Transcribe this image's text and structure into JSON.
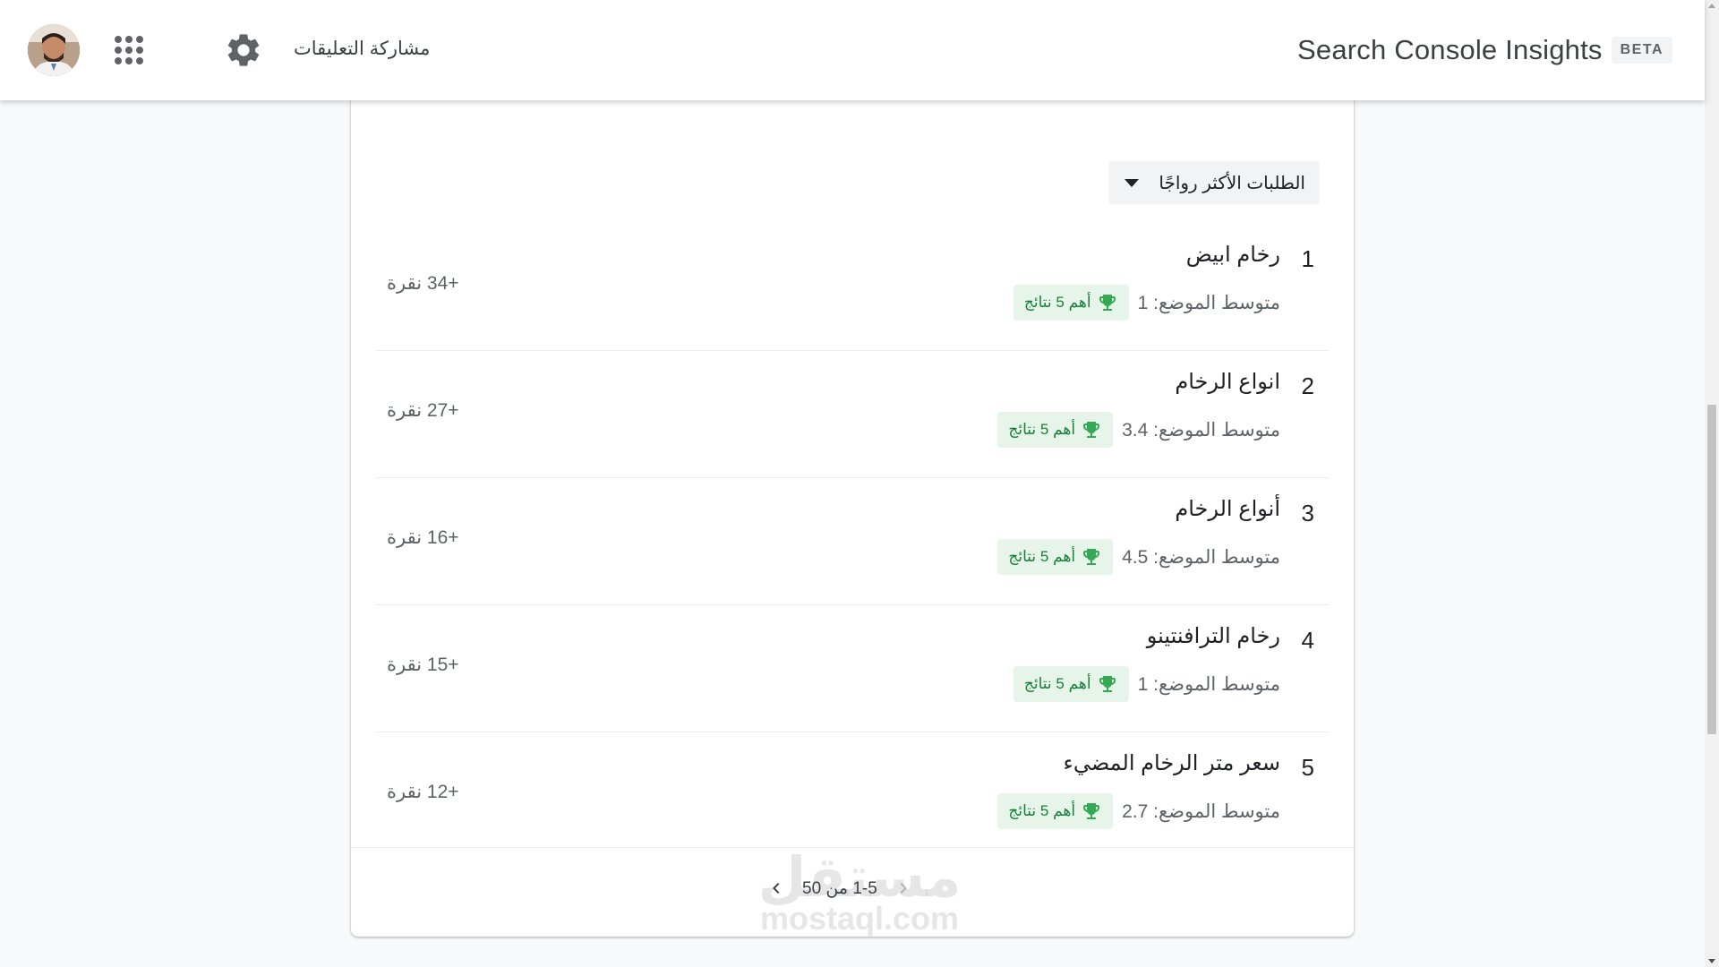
{
  "header": {
    "title": "Search Console Insights",
    "badge": "BETA",
    "feedback_label": "مشاركة التعليقات",
    "avatar_icon": "user-avatar-photo",
    "apps_icon": "apps-grid-icon",
    "settings_icon": "gear-icon"
  },
  "queries_card": {
    "dropdown_label": "الطلبات الأكثر رواجًا",
    "dropdown_icon": "caret-down-icon",
    "badge_icon": "trophy-icon",
    "items": [
      {
        "rank": "1",
        "query": "رخام ابيض",
        "avg_position": "متوسط الموضع: 1",
        "badge": "أهم 5 نتائج",
        "clicks": "+34 نقرة"
      },
      {
        "rank": "2",
        "query": "انواع الرخام",
        "avg_position": "متوسط الموضع: 3.4",
        "badge": "أهم 5 نتائج",
        "clicks": "+27 نقرة"
      },
      {
        "rank": "3",
        "query": "أنواع الرخام",
        "avg_position": "متوسط الموضع: 4.5",
        "badge": "أهم 5 نتائج",
        "clicks": "+16 نقرة"
      },
      {
        "rank": "4",
        "query": "رخام الترافنتينو",
        "avg_position": "متوسط الموضع: 1",
        "badge": "أهم 5 نتائج",
        "clicks": "+15 نقرة"
      },
      {
        "rank": "5",
        "query": "سعر متر الرخام المضيء",
        "avg_position": "متوسط الموضع: 2.7",
        "badge": "أهم 5 نتائج",
        "clicks": "+12 نقرة"
      }
    ],
    "pagination": {
      "label": "1-5 من 50",
      "prev_icon": "chevron-left-icon",
      "next_icon": "chevron-right-icon"
    }
  },
  "watermark": {
    "arabic": "مستقل",
    "latin": "mostaql.com"
  },
  "colors": {
    "badge_bg": "#e6f4ea",
    "badge_fg": "#188038",
    "trophy": "#34a853"
  }
}
